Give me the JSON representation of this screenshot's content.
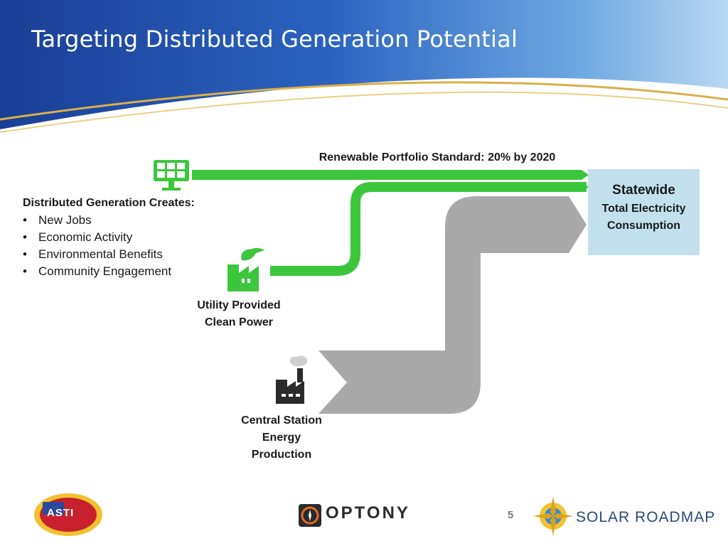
{
  "slide": {
    "title": "Targeting Distributed Generation Potential",
    "page_number": "5"
  },
  "diagram": {
    "rps_label": "Renewable Portfolio Standard: 20% by 2020",
    "distributed_generation": {
      "heading": "Distributed Generation Creates:",
      "items": [
        "New Jobs",
        "Economic Activity",
        "Environmental Benefits",
        "Community Engagement"
      ]
    },
    "utility_label_line1": "Utility Provided",
    "utility_label_line2": "Clean Power",
    "central_label_line1": "Central Station",
    "central_label_line2": "Energy",
    "central_label_line3": "Production",
    "statewide_title": "Statewide",
    "statewide_line1": "Total Electricity",
    "statewide_line2": "Consumption",
    "icons": [
      "solar-panel-icon",
      "green-factory-icon",
      "smokestack-factory-icon"
    ]
  },
  "colors": {
    "title_bar": "#1f4fa8",
    "green_flow": "#3cc63c",
    "gray_flow": "#a9a9a9",
    "statewide_box": "#c2e1ec",
    "gold_swoosh": "#d9b04a"
  },
  "logos": {
    "asti": "ASTI",
    "optony": "OPTONY",
    "solar_roadmap": "SOLAR ROADMAP"
  }
}
